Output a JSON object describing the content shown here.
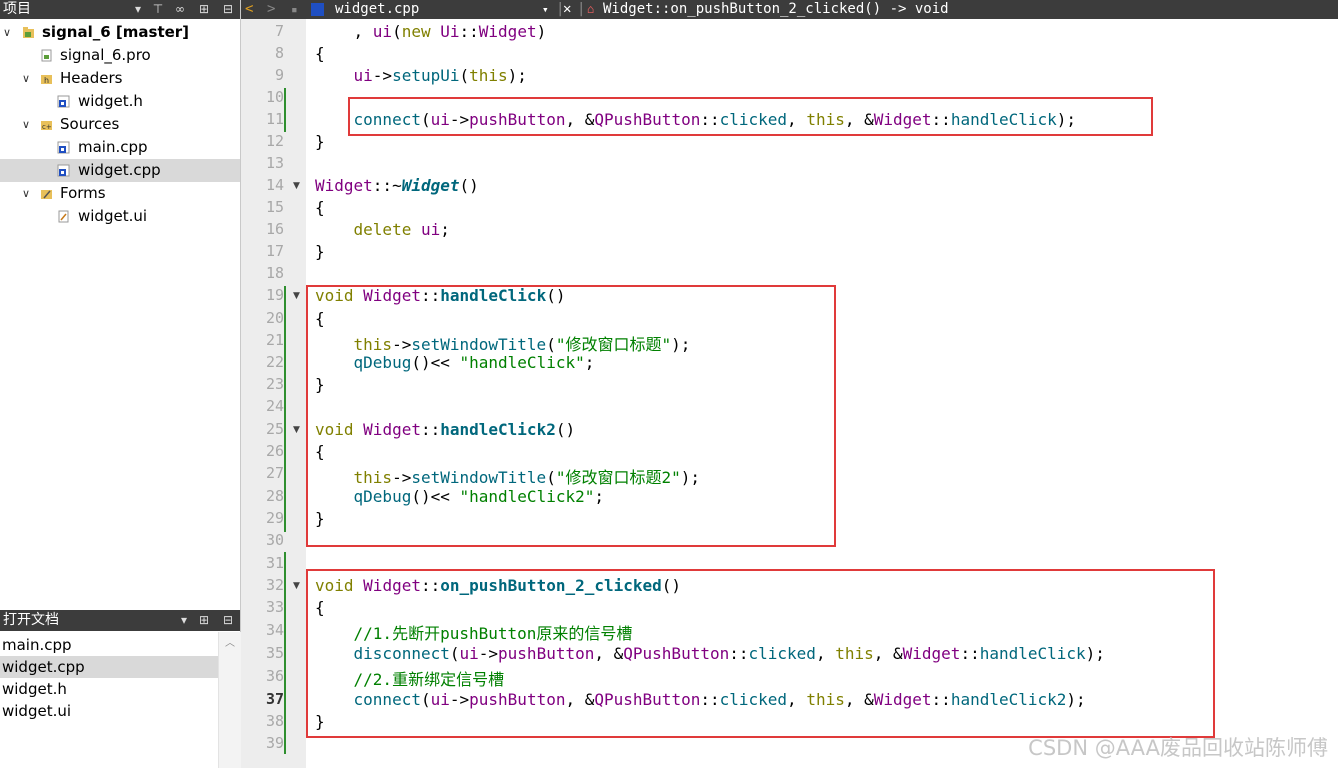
{
  "project_panel": {
    "title": "项目",
    "tree": [
      {
        "label": "signal_6 [master]",
        "icon": "project-icon",
        "expanded": true,
        "bold": true
      },
      {
        "label": "signal_6.pro",
        "icon": "pro-file-icon"
      },
      {
        "label": "Headers",
        "icon": "headers-folder-icon",
        "expanded": true
      },
      {
        "label": "widget.h",
        "icon": "header-file-icon"
      },
      {
        "label": "Sources",
        "icon": "sources-folder-icon",
        "expanded": true
      },
      {
        "label": "main.cpp",
        "icon": "cpp-file-icon"
      },
      {
        "label": "widget.cpp",
        "icon": "cpp-file-icon",
        "selected": true
      },
      {
        "label": "Forms",
        "icon": "forms-folder-icon",
        "expanded": true
      },
      {
        "label": "widget.ui",
        "icon": "ui-file-icon"
      }
    ]
  },
  "open_docs": {
    "title": "打开文档",
    "items": [
      "main.cpp",
      "widget.cpp",
      "widget.h",
      "widget.ui"
    ],
    "selected_index": 1
  },
  "editor": {
    "file_name": "widget.cpp",
    "symbol": "Widget::on_pushButton_2_clicked() -> void",
    "current_line": 37,
    "line_numbers": [
      "7",
      "8",
      "9",
      "10",
      "11",
      "12",
      "13",
      "14",
      "15",
      "16",
      "17",
      "18",
      "19",
      "20",
      "21",
      "22",
      "23",
      "24",
      "25",
      "26",
      "27",
      "28",
      "29",
      "30",
      "31",
      "32",
      "33",
      "34",
      "35",
      "36",
      "37",
      "38",
      "39"
    ],
    "code": {
      "l7_a": "    , ",
      "l7_b": "ui",
      "l7_c": "(",
      "l7_d": "new",
      "l7_e": " ",
      "l7_f": "Ui",
      "l7_g": "::",
      "l7_h": "Widget",
      "l7_i": ")",
      "l8": "{",
      "l9_a": "    ",
      "l9_b": "ui",
      "l9_c": "->",
      "l9_d": "setupUi",
      "l9_e": "(",
      "l9_f": "this",
      "l9_g": ");",
      "l11_a": "    ",
      "l11_b": "connect",
      "l11_c": "(",
      "l11_d": "ui",
      "l11_e": "->",
      "l11_f": "pushButton",
      "l11_g": ", &",
      "l11_h": "QPushButton",
      "l11_i": "::",
      "l11_j": "clicked",
      "l11_k": ", ",
      "l11_l": "this",
      "l11_m": ", &",
      "l11_n": "Widget",
      "l11_o": "::",
      "l11_p": "handleClick",
      "l11_q": ");",
      "l12": "}",
      "l14_a": "Widget",
      "l14_b": "::~",
      "l14_c": "Widget",
      "l14_d": "()",
      "l15": "{",
      "l16_a": "    ",
      "l16_b": "delete",
      "l16_c": " ",
      "l16_d": "ui",
      "l16_e": ";",
      "l17": "}",
      "l19_a": "void",
      "l19_b": " ",
      "l19_c": "Widget",
      "l19_d": "::",
      "l19_e": "handleClick",
      "l19_f": "()",
      "l20": "{",
      "l21_a": "    ",
      "l21_b": "this",
      "l21_c": "->",
      "l21_d": "setWindowTitle",
      "l21_e": "(",
      "l21_f": "\"修改窗口标题\"",
      "l21_g": ");",
      "l22_a": "    ",
      "l22_b": "qDebug",
      "l22_c": "()<< ",
      "l22_d": "\"handleClick\"",
      "l22_e": ";",
      "l23": "}",
      "l25_a": "void",
      "l25_b": " ",
      "l25_c": "Widget",
      "l25_d": "::",
      "l25_e": "handleClick2",
      "l25_f": "()",
      "l26": "{",
      "l27_a": "    ",
      "l27_b": "this",
      "l27_c": "->",
      "l27_d": "setWindowTitle",
      "l27_e": "(",
      "l27_f": "\"修改窗口标题2\"",
      "l27_g": ");",
      "l28_a": "    ",
      "l28_b": "qDebug",
      "l28_c": "()<< ",
      "l28_d": "\"handleClick2\"",
      "l28_e": ";",
      "l29": "}",
      "l32_a": "void",
      "l32_b": " ",
      "l32_c": "Widget",
      "l32_d": "::",
      "l32_e": "on_pushButton_2_clicked",
      "l32_f": "()",
      "l33": "{",
      "l34": "    //1.先断开pushButton原来的信号槽",
      "l35_a": "    ",
      "l35_b": "disconnect",
      "l35_c": "(",
      "l35_d": "ui",
      "l35_e": "->",
      "l35_f": "pushButton",
      "l35_g": ", &",
      "l35_h": "QPushButton",
      "l35_i": "::",
      "l35_j": "clicked",
      "l35_k": ", ",
      "l35_l": "this",
      "l35_m": ", &",
      "l35_n": "Widget",
      "l35_o": "::",
      "l35_p": "handleClick",
      "l35_q": ");",
      "l36": "    //2.重新绑定信号槽",
      "l37_a": "    ",
      "l37_b": "connect",
      "l37_c": "(",
      "l37_d": "ui",
      "l37_e": "->",
      "l37_f": "pushButton",
      "l37_g": ", &",
      "l37_h": "QPushButton",
      "l37_i": "::",
      "l37_j": "clicked",
      "l37_k": ", ",
      "l37_l": "this",
      "l37_m": ", &",
      "l37_n": "Widget",
      "l37_o": "::",
      "l37_p": "handleClick2",
      "l37_q": ");",
      "l38": "}"
    }
  },
  "watermark": "CSDN @AAA废品回收站陈师傅",
  "colors": {
    "keyword": "#808000",
    "type": "#800080",
    "function": "#00677c",
    "string": "#008000",
    "comment": "#008000",
    "highlight_box": "#e03a3a",
    "change_bar": "#2f8f2f",
    "toolbar": "#3c3c3c"
  }
}
